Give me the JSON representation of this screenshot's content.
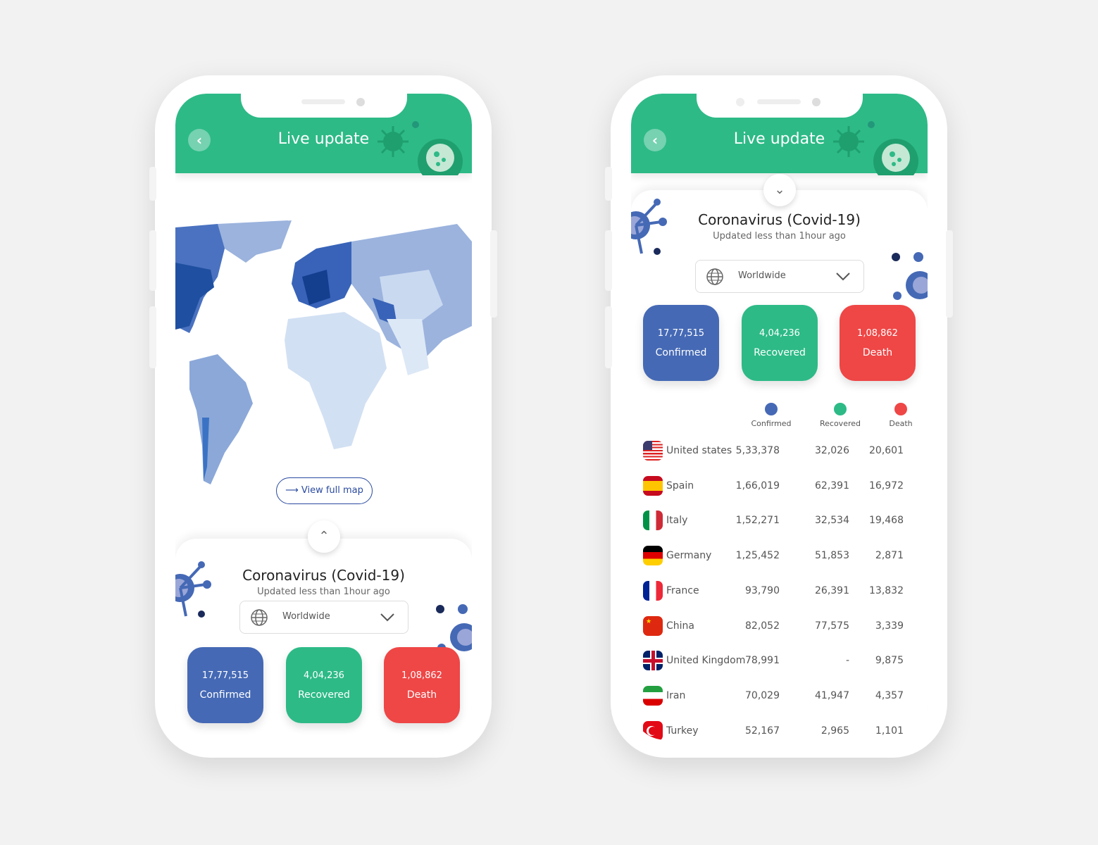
{
  "colors": {
    "green": "#2dba87",
    "blue": "#4569b5",
    "red": "#ef4646"
  },
  "header": {
    "title": "Live update",
    "back_icon": "chevron-left-icon"
  },
  "map": {
    "view_full_map_label": "View full map"
  },
  "summary": {
    "title": "Coronavirus (Covid-19)",
    "subtitle": "Updated less than 1hour ago",
    "region_select": {
      "value": "Worldwide"
    },
    "stats": [
      {
        "value": "17,77,515",
        "label": "Confirmed",
        "color": "#4569b5"
      },
      {
        "value": "4,04,236",
        "label": "Recovered",
        "color": "#2dba87"
      },
      {
        "value": "1,08,862",
        "label": "Death",
        "color": "#ef4646"
      }
    ]
  },
  "table": {
    "columns": [
      {
        "label": "Confirmed",
        "color": "#4569b5"
      },
      {
        "label": "Recovered",
        "color": "#2dba87"
      },
      {
        "label": "Death",
        "color": "#ef4646"
      }
    ],
    "rows": [
      {
        "country": "United states",
        "flag": "us",
        "confirmed": "5,33,378",
        "recovered": "32,026",
        "death": "20,601"
      },
      {
        "country": "Spain",
        "flag": "es",
        "confirmed": "1,66,019",
        "recovered": "62,391",
        "death": "16,972"
      },
      {
        "country": "Italy",
        "flag": "it",
        "confirmed": "1,52,271",
        "recovered": "32,534",
        "death": "19,468"
      },
      {
        "country": "Germany",
        "flag": "de",
        "confirmed": "1,25,452",
        "recovered": "51,853",
        "death": "2,871"
      },
      {
        "country": "France",
        "flag": "fr",
        "confirmed": "93,790",
        "recovered": "26,391",
        "death": "13,832"
      },
      {
        "country": "China",
        "flag": "cn",
        "confirmed": "82,052",
        "recovered": "77,575",
        "death": "3,339"
      },
      {
        "country": "United Kingdom",
        "flag": "gb",
        "confirmed": "78,991",
        "recovered": "-",
        "death": "9,875"
      },
      {
        "country": "Iran",
        "flag": "ir",
        "confirmed": "70,029",
        "recovered": "41,947",
        "death": "4,357"
      },
      {
        "country": "Turkey",
        "flag": "tr",
        "confirmed": "52,167",
        "recovered": "2,965",
        "death": "1,101"
      }
    ]
  }
}
